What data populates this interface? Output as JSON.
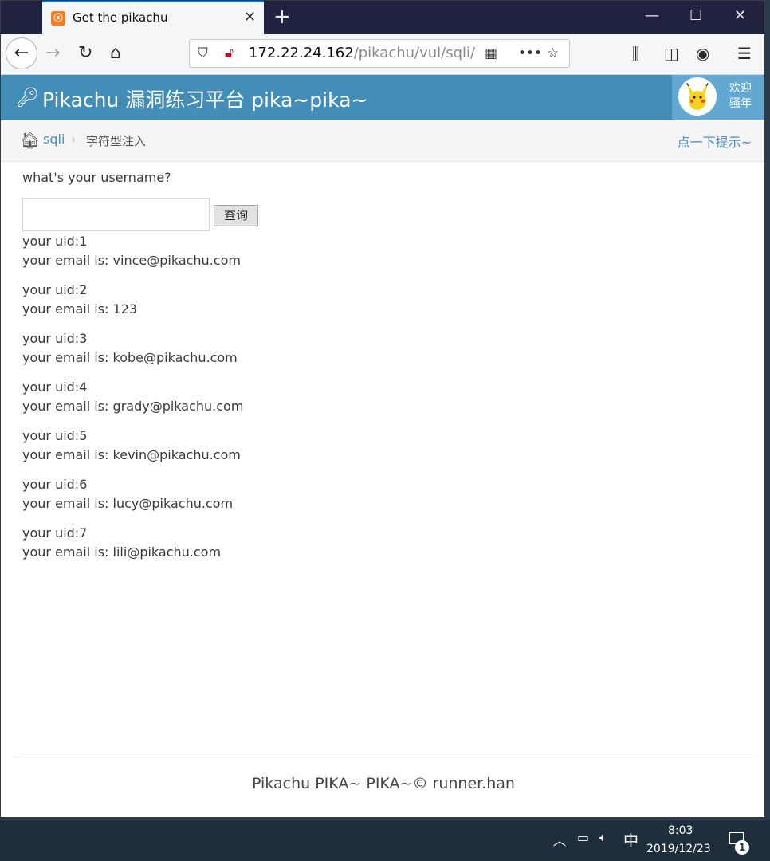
{
  "browser": {
    "tab_title": "Get the pikachu",
    "url_host": "172.22.24.162",
    "url_path": "/pikachu/vul/sqli/"
  },
  "header": {
    "brand": "Pikachu 漏洞练习平台 pika~pika~",
    "welcome_line1": "欢迎",
    "welcome_line2": "骚年"
  },
  "breadcrumb": {
    "link": "sqli",
    "current": "字符型注入",
    "hint": "点一下提示~"
  },
  "form": {
    "question": "what's your username?",
    "input_value": "",
    "submit_label": "查询"
  },
  "results": [
    {
      "uid": "your uid:1",
      "email": "your email is: vince@pikachu.com"
    },
    {
      "uid": "your uid:2",
      "email": "your email is: 123"
    },
    {
      "uid": "your uid:3",
      "email": "your email is: kobe@pikachu.com"
    },
    {
      "uid": "your uid:4",
      "email": "your email is: grady@pikachu.com"
    },
    {
      "uid": "your uid:5",
      "email": "your email is: kevin@pikachu.com"
    },
    {
      "uid": "your uid:6",
      "email": "your email is: lucy@pikachu.com"
    },
    {
      "uid": "your uid:7",
      "email": "your email is: lili@pikachu.com"
    }
  ],
  "footer": "Pikachu PIKA~ PIKA~© runner.han",
  "taskbar": {
    "ime": "中",
    "time": "8:03",
    "date": "2019/12/23",
    "notifications": "1"
  },
  "colors": {
    "header_bg": "#438eb9",
    "link": "#4c8fbd"
  }
}
